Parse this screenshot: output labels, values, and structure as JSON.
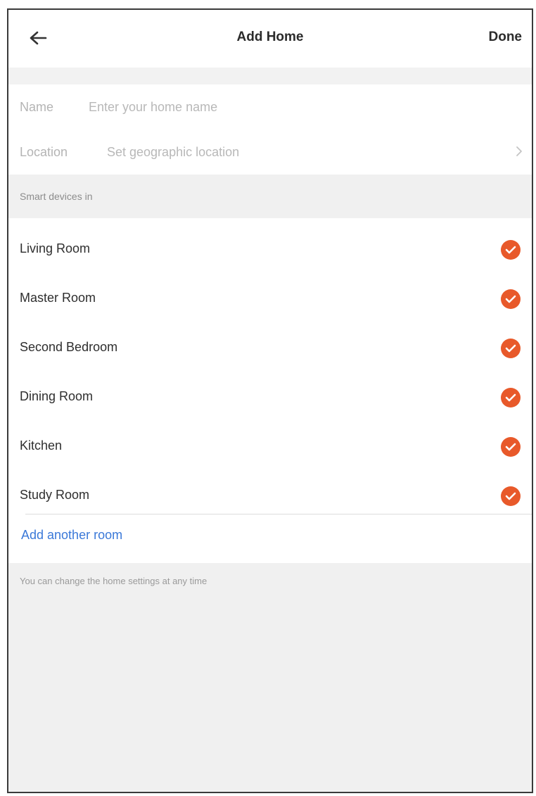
{
  "header": {
    "title": "Add Home",
    "done_label": "Done",
    "back_icon": "arrow-left-icon"
  },
  "form": {
    "name": {
      "label": "Name",
      "placeholder": "Enter your home name"
    },
    "location": {
      "label": "Location",
      "placeholder": "Set geographic location",
      "icon": "chevron-right-icon"
    }
  },
  "rooms_section": {
    "header": "Smart devices in",
    "rooms": [
      {
        "name": "Living Room",
        "selected": true
      },
      {
        "name": "Master Room",
        "selected": true
      },
      {
        "name": "Second Bedroom",
        "selected": true
      },
      {
        "name": "Dining Room",
        "selected": true
      },
      {
        "name": "Kitchen",
        "selected": true
      },
      {
        "name": "Study Room",
        "selected": true
      }
    ],
    "add_room_label": "Add another room"
  },
  "footer_note": "You can change the home settings at any time",
  "colors": {
    "accent": "#e8592a",
    "link": "#3a78d8",
    "background": "#f0f0f0"
  }
}
